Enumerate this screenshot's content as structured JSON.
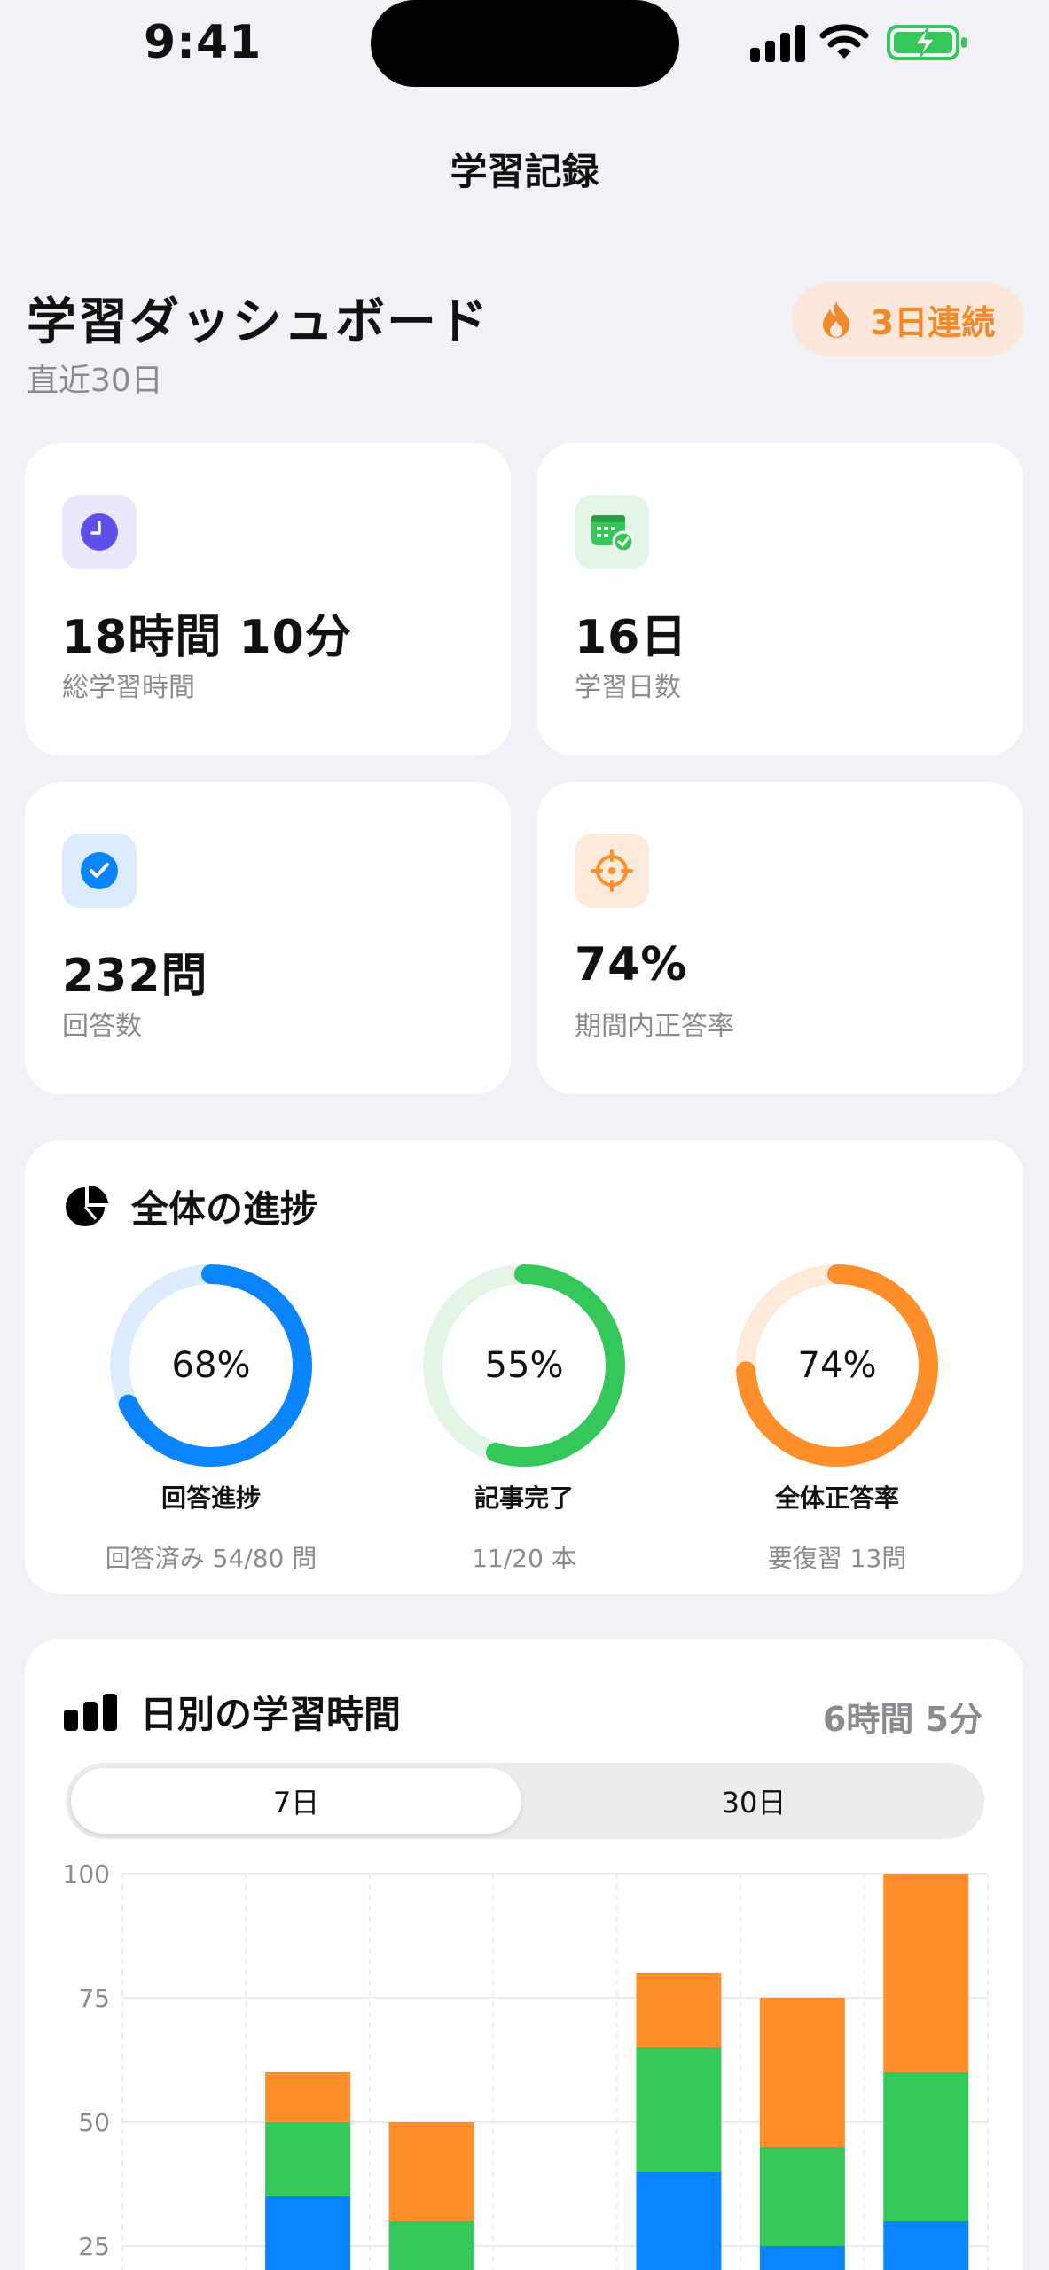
{
  "status": {
    "time": "9:41"
  },
  "nav": {
    "title": "学習記録"
  },
  "header": {
    "title": "学習ダッシュボード",
    "subtitle": "直近30日",
    "streak": "3日連続"
  },
  "stats": [
    {
      "value": "18時間 10分",
      "label": "総学習時間",
      "icon": "clock-icon",
      "color": "#5e4fe8"
    },
    {
      "value": "16日",
      "label": "学習日数",
      "icon": "calendar-check-icon",
      "color": "#34c759"
    },
    {
      "value": "232問",
      "label": "回答数",
      "icon": "checkmark-circle-icon",
      "color": "#0a84ff"
    },
    {
      "value": "74%",
      "label": "期間内正答率",
      "icon": "target-icon",
      "color": "#ff8f2a"
    }
  ],
  "progress": {
    "title": "全体の進捗",
    "rings": [
      {
        "pct": "68%",
        "value": 0.68,
        "label": "回答進捗",
        "sub": "回答済み 54/80 問",
        "color": "#0a84ff",
        "track": "#dcecfc"
      },
      {
        "pct": "55%",
        "value": 0.55,
        "label": "記事完了",
        "sub": "11/20 本",
        "color": "#34c759",
        "track": "#e2f5e6"
      },
      {
        "pct": "74%",
        "value": 0.74,
        "label": "全体正答率",
        "sub": "要復習 13問",
        "color": "#ff8f2a",
        "track": "#fdeadb"
      }
    ]
  },
  "daily": {
    "title": "日別の学習時間",
    "total": "6時間 5分",
    "segments": [
      "7日",
      "30日"
    ],
    "active_segment": "7日"
  },
  "chart_data": {
    "type": "bar",
    "stacked": true,
    "ylim": [
      0,
      100
    ],
    "yticks": [
      "100",
      "75",
      "50",
      "25"
    ],
    "yticks_values": [
      100,
      75,
      50,
      25
    ],
    "categories": 7,
    "series": [
      {
        "color": "#0a84ff",
        "values": [
          0,
          35,
          0,
          0,
          40,
          25,
          30
        ]
      },
      {
        "color": "#34c759",
        "values": [
          0,
          15,
          30,
          0,
          25,
          20,
          30
        ]
      },
      {
        "color": "#ff8f2a",
        "values": [
          0,
          10,
          20,
          0,
          15,
          30,
          40
        ]
      }
    ]
  }
}
